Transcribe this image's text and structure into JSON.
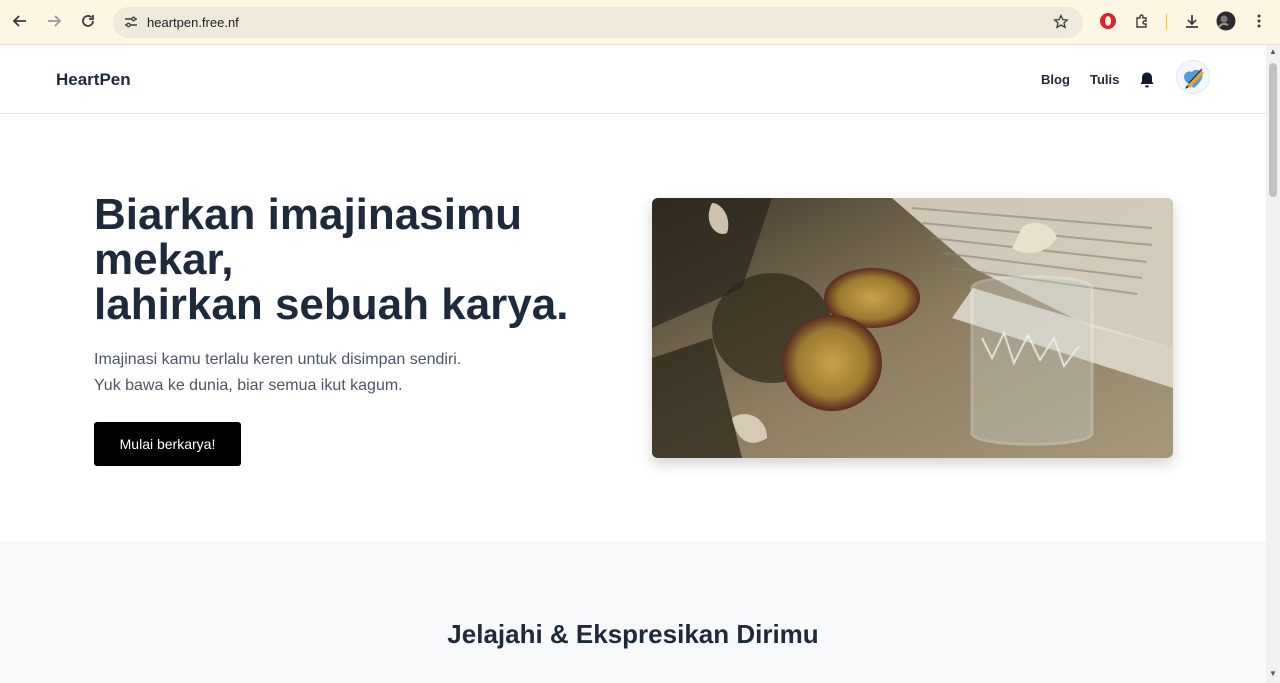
{
  "browser": {
    "url": "heartpen.free.nf",
    "icons": [
      "back-arrow-icon",
      "forward-arrow-icon",
      "reload-icon",
      "site-settings-icon",
      "bookmark-star-icon",
      "opera-extension-icon",
      "extensions-puzzle-icon",
      "download-icon",
      "profile-avatar-icon",
      "menu-dots-icon"
    ]
  },
  "navbar": {
    "brand": "HeartPen",
    "links": [
      "Blog",
      "Tulis"
    ],
    "icons": [
      "bell-icon",
      "user-avatar"
    ]
  },
  "hero": {
    "title_lines": [
      "Biarkan imajinasimu",
      "mekar,",
      "lahirkan sebuah karya."
    ],
    "subtitle_lines": [
      "Imajinasi kamu terlalu keren untuk disimpan sendiri.",
      "Yuk bawa ke dunia, biar semua ikut kagum."
    ],
    "cta": "Mulai berkarya!"
  },
  "section2": {
    "title": "Jelajahi & Ekspresikan Dirimu"
  },
  "colors": {
    "chrome_bg": "#fdf6e3",
    "text_dark": "#1e293b",
    "button_bg": "#000000",
    "section_bg": "#f8f9fb"
  }
}
